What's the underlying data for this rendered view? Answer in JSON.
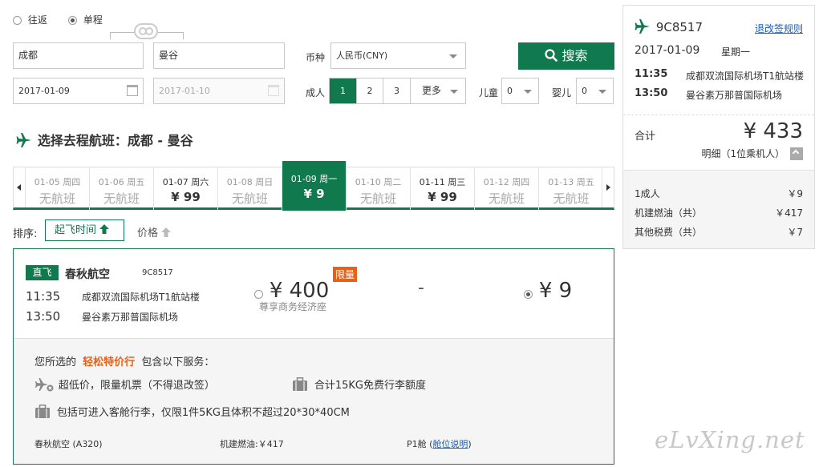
{
  "trip_type": {
    "round_trip": "往返",
    "one_way": "单程"
  },
  "search": {
    "from_city": "成都",
    "to_city": "曼谷",
    "depart_date": "2017-01-09",
    "return_date": "2017-01-10",
    "currency_label": "币种",
    "currency_value": "人民币(CNY)",
    "search_button": "搜索",
    "adult_label": "成人",
    "adult_options": [
      "1",
      "2",
      "3"
    ],
    "more_label": "更多",
    "child_label": "儿童",
    "child_value": "0",
    "infant_label": "婴儿",
    "infant_value": "0"
  },
  "section_title": "选择去程航班：成都 - 曼谷",
  "date_tabs": [
    {
      "date": "01-05",
      "weekday": "周四",
      "price": "无航班",
      "has": false
    },
    {
      "date": "01-06",
      "weekday": "周五",
      "price": "无航班",
      "has": false
    },
    {
      "date": "01-07",
      "weekday": "周六",
      "price": "¥ 99",
      "has": true
    },
    {
      "date": "01-08",
      "weekday": "周日",
      "price": "无航班",
      "has": false
    },
    {
      "date": "01-09",
      "weekday": "周一",
      "price": "¥ 9",
      "has": true,
      "active": true
    },
    {
      "date": "01-10",
      "weekday": "周二",
      "price": "无航班",
      "has": false
    },
    {
      "date": "01-11",
      "weekday": "周三",
      "price": "¥ 99",
      "has": true
    },
    {
      "date": "01-12",
      "weekday": "周四",
      "price": "无航班",
      "has": false
    },
    {
      "date": "01-13",
      "weekday": "周五",
      "price": "无航班",
      "has": false
    }
  ],
  "sort": {
    "label": "排序:",
    "by_time": "起飞时间",
    "by_price": "价格"
  },
  "flight": {
    "tag": "直飞",
    "airline": "春秋航空",
    "number": "9C8517",
    "dep_time": "11:35",
    "dep_airport": "成都双流国际机场T1航站楼",
    "arr_time": "13:50",
    "arr_airport": "曼谷素万那普国际机场",
    "fare1_price": "¥ 400",
    "fare1_badge": "限量",
    "fare1_class": "尊享商务经济座",
    "fare2_dash": "-",
    "fare3_price": "¥ 9"
  },
  "services": {
    "prefix": "您所选的",
    "fare_name": "轻松特价行",
    "suffix": "包含以下服务：",
    "item1": "超低价，限量机票（不得退改签）",
    "item2": "合计15KG免费行李额度",
    "item3": "包括可进入客舱行李，仅限1件5KG且体积不超过20*30*40CM",
    "aircraft": "春秋航空 (A320)",
    "fuel": "机建燃油:￥417",
    "cabin_prefix": "P1舱 (",
    "cabin_link": "舱位说明",
    "cabin_suffix": ")"
  },
  "summary": {
    "flight_no": "9C8517",
    "rules_link": "退改签规则",
    "date": "2017-01-09",
    "weekday": "星期一",
    "dep_time": "11:35",
    "dep_airport": "成都双流国际机场T1航站楼",
    "arr_time": "13:50",
    "arr_airport": "曼谷素万那普国际机场",
    "total_label": "合计",
    "total_value": "¥ 433",
    "detail_label": "明细（1位乘机人）",
    "rows": [
      {
        "label": "1成人",
        "value": "￥9"
      },
      {
        "label": "机建燃油（共）",
        "value": "￥417"
      },
      {
        "label": "其他税费（共）",
        "value": "￥7"
      }
    ]
  },
  "watermark": "eLvXing.net",
  "colors": {
    "brand_green": "#107a4e",
    "orange": "#e8611a",
    "link_blue": "#1a5fb4"
  }
}
